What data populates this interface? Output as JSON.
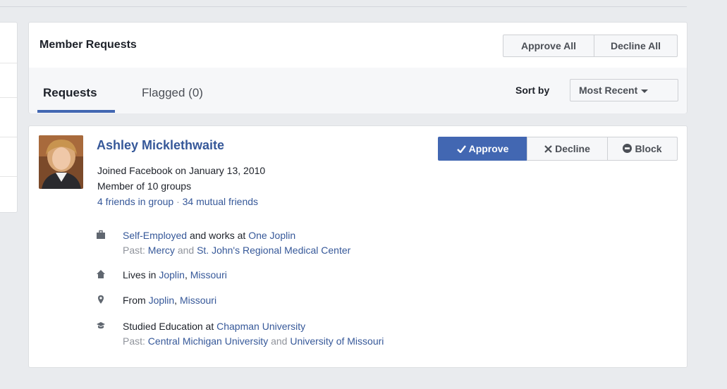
{
  "header": {
    "title": "Member Requests",
    "approve_all": "Approve All",
    "decline_all": "Decline All"
  },
  "tabs": {
    "requests": "Requests",
    "flagged": "Flagged (0)"
  },
  "sort": {
    "label": "Sort by",
    "value": "Most Recent"
  },
  "request": {
    "name": "Ashley Micklethwaite",
    "joined": "Joined Facebook on January 13, 2010",
    "groups": "Member of 10 groups",
    "friends_in_group": "4 friends in group",
    "separator": "·",
    "mutual_friends": "34 mutual friends",
    "actions": {
      "approve": "Approve",
      "decline": "Decline",
      "block": "Block"
    },
    "details": {
      "work": {
        "employer": "Self-Employed",
        "connector": "and works at",
        "workplace": "One Joplin",
        "past_label": "Past:",
        "past1": "Mercy",
        "past_and": "and",
        "past2": "St. John's Regional Medical Center"
      },
      "lives": {
        "prefix": "Lives in",
        "city": "Joplin",
        "comma": ",",
        "state": "Missouri"
      },
      "from": {
        "prefix": "From",
        "city": "Joplin",
        "comma": ",",
        "state": "Missouri"
      },
      "education": {
        "prefix": "Studied Education at",
        "school": "Chapman University",
        "past_label": "Past:",
        "past1": "Central Michigan University",
        "past_and": "and",
        "past2": "University of Missouri"
      }
    }
  },
  "colors": {
    "link": "#365899",
    "primary": "#4267b2",
    "background": "#e9ebee"
  }
}
